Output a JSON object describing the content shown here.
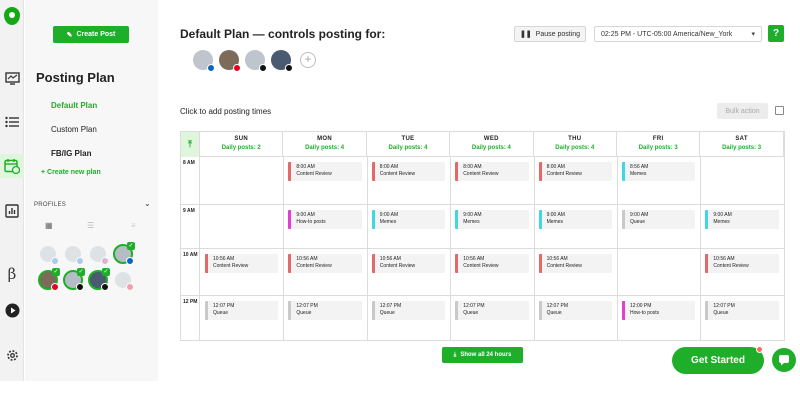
{
  "sidebar": {
    "create_post_label": "Create Post",
    "title": "Posting Plan",
    "plans": [
      "Default Plan",
      "Custom Plan",
      "FB/IG Plan"
    ],
    "create_plan_label": "+ Create new plan",
    "profiles_label": "PROFILES"
  },
  "header": {
    "title": "Default Plan — controls posting for:",
    "pause_label": "Pause posting",
    "timezone": "02:25 PM - UTC-05:00 America/New_York",
    "help_label": "?",
    "click_hint": "Click to add posting times",
    "bulk_label": "Bulk action"
  },
  "calendar": {
    "days": [
      {
        "name": "SUN",
        "count": "Daily posts: 2"
      },
      {
        "name": "MON",
        "count": "Daily posts: 4"
      },
      {
        "name": "TUE",
        "count": "Daily posts: 4"
      },
      {
        "name": "WED",
        "count": "Daily posts: 4"
      },
      {
        "name": "THU",
        "count": "Daily posts: 4"
      },
      {
        "name": "FRI",
        "count": "Daily posts: 3"
      },
      {
        "name": "SAT",
        "count": "Daily posts: 3"
      }
    ],
    "times": [
      "8 AM",
      "9 AM",
      "10 AM",
      "12 PM"
    ],
    "categories": {
      "content_review": {
        "label": "Content Review",
        "color": "#e06a6a"
      },
      "how_to": {
        "label": "How-to posts",
        "color": "#e23fd0"
      },
      "memes": {
        "label": "Memes",
        "color": "#3fd8e0"
      },
      "queue": {
        "label": "Queue",
        "color": "#c9c9c9"
      }
    },
    "posts": [
      {
        "day": 1,
        "row": 0,
        "time": "8:00 AM",
        "cat": "content_review"
      },
      {
        "day": 2,
        "row": 0,
        "time": "8:00 AM",
        "cat": "content_review"
      },
      {
        "day": 3,
        "row": 0,
        "time": "8:00 AM",
        "cat": "content_review"
      },
      {
        "day": 4,
        "row": 0,
        "time": "8:00 AM",
        "cat": "content_review"
      },
      {
        "day": 5,
        "row": 0,
        "time": "8:56 AM",
        "cat": "memes"
      },
      {
        "day": 1,
        "row": 1,
        "time": "9:00 AM",
        "cat": "how_to"
      },
      {
        "day": 2,
        "row": 1,
        "time": "9:00 AM",
        "cat": "memes"
      },
      {
        "day": 3,
        "row": 1,
        "time": "9:00 AM",
        "cat": "memes"
      },
      {
        "day": 4,
        "row": 1,
        "time": "9:00 AM",
        "cat": "memes"
      },
      {
        "day": 5,
        "row": 1,
        "time": "9:00 AM",
        "cat": "queue"
      },
      {
        "day": 6,
        "row": 1,
        "time": "9:00 AM",
        "cat": "memes"
      },
      {
        "day": 0,
        "row": 2,
        "time": "10:56 AM",
        "cat": "content_review"
      },
      {
        "day": 1,
        "row": 2,
        "time": "10:56 AM",
        "cat": "content_review"
      },
      {
        "day": 2,
        "row": 2,
        "time": "10:56 AM",
        "cat": "content_review"
      },
      {
        "day": 3,
        "row": 2,
        "time": "10:56 AM",
        "cat": "content_review"
      },
      {
        "day": 4,
        "row": 2,
        "time": "10:56 AM",
        "cat": "content_review"
      },
      {
        "day": 6,
        "row": 2,
        "time": "10:56 AM",
        "cat": "content_review"
      },
      {
        "day": 0,
        "row": 3,
        "time": "12:07 PM",
        "cat": "queue"
      },
      {
        "day": 1,
        "row": 3,
        "time": "12:07 PM",
        "cat": "queue"
      },
      {
        "day": 2,
        "row": 3,
        "time": "12:07 PM",
        "cat": "queue"
      },
      {
        "day": 3,
        "row": 3,
        "time": "12:07 PM",
        "cat": "queue"
      },
      {
        "day": 4,
        "row": 3,
        "time": "12:07 PM",
        "cat": "queue"
      },
      {
        "day": 5,
        "row": 3,
        "time": "12:00 PM",
        "cat": "how_to"
      },
      {
        "day": 6,
        "row": 3,
        "time": "12:07 PM",
        "cat": "queue"
      }
    ],
    "show_all_label": "Show all 24 hours"
  },
  "footer": {
    "get_started_label": "Get Started"
  },
  "colors": {
    "accent": "#1fae2a",
    "linkedin": "#0a66c2",
    "pinterest": "#e60023",
    "tiktok": "#111111",
    "x": "#111111"
  },
  "header_profiles": [
    {
      "network": "linkedin"
    },
    {
      "network": "pinterest"
    },
    {
      "network": "tiktok"
    },
    {
      "network": "x"
    }
  ]
}
